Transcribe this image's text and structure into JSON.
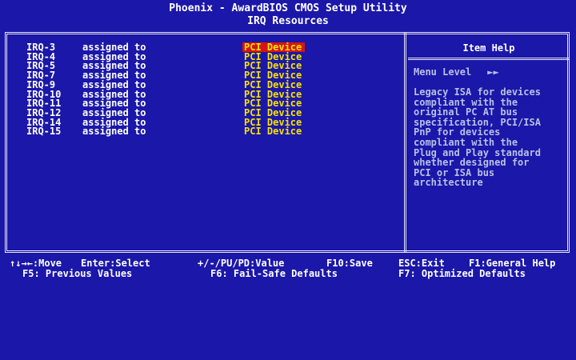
{
  "window": {
    "title": "Phoenix - AwardBIOS CMOS Setup Utility",
    "subtitle": "IRQ Resources"
  },
  "irq_rows": [
    {
      "name": "IRQ-3",
      "label": "assigned to",
      "value": "PCI Device",
      "selected": true
    },
    {
      "name": "IRQ-4",
      "label": "assigned to",
      "value": "PCI Device",
      "selected": false
    },
    {
      "name": "IRQ-5",
      "label": "assigned to",
      "value": "PCI Device",
      "selected": false
    },
    {
      "name": "IRQ-7",
      "label": "assigned to",
      "value": "PCI Device",
      "selected": false
    },
    {
      "name": "IRQ-9",
      "label": "assigned to",
      "value": "PCI Device",
      "selected": false
    },
    {
      "name": "IRQ-10",
      "label": "assigned to",
      "value": "PCI Device",
      "selected": false
    },
    {
      "name": "IRQ-11",
      "label": "assigned to",
      "value": "PCI Device",
      "selected": false
    },
    {
      "name": "IRQ-12",
      "label": "assigned to",
      "value": "PCI Device",
      "selected": false
    },
    {
      "name": "IRQ-14",
      "label": "assigned to",
      "value": "PCI Device",
      "selected": false
    },
    {
      "name": "IRQ-15",
      "label": "assigned to",
      "value": "PCI Device",
      "selected": false
    }
  ],
  "help": {
    "header": "Item Help",
    "menu_level_label": "Menu Level",
    "menu_level_arrows": "►►",
    "lines": [
      "Legacy ISA for devices",
      "compliant with the",
      "original PC AT bus",
      "specification, PCI/ISA",
      "PnP for devices",
      "compliant with the",
      "Plug and Play standard",
      "whether designed for",
      "PCI or ISA bus",
      "architecture"
    ]
  },
  "footer": {
    "move": "↑↓→←:Move",
    "select": "Enter:Select",
    "value": "+/-/PU/PD:Value",
    "save": "F10:Save",
    "exit": "ESC:Exit",
    "general_help": "F1:General Help",
    "previous_values": "F5: Previous Values",
    "fail_safe": "F6: Fail-Safe Defaults",
    "optimized": "F7: Optimized Defaults"
  },
  "colors": {
    "background": "#1b17a8",
    "value_text": "#f7e300",
    "selection": "#d41515",
    "help_text": "#b8c0e8"
  }
}
